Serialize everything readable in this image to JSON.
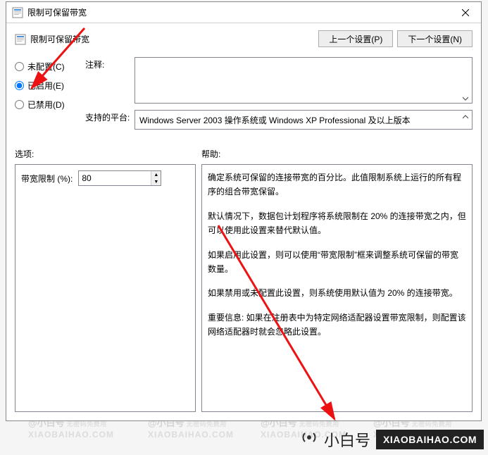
{
  "window": {
    "title": "限制可保留带宽"
  },
  "header": {
    "policy_name": "限制可保留带宽",
    "prev_btn": "上一个设置(P)",
    "next_btn": "下一个设置(N)"
  },
  "config": {
    "radios": {
      "not_configured": "未配置(C)",
      "enabled": "已启用(E)",
      "disabled": "已禁用(D)"
    },
    "selected": "enabled",
    "comment_label": "注释:",
    "comment_value": "",
    "platform_label": "支持的平台:",
    "platform_value": "Windows Server 2003 操作系统或 Windows XP Professional 及以上版本"
  },
  "sections": {
    "options_label": "选项:",
    "help_label": "帮助:"
  },
  "options": {
    "bandwidth_limit_label": "带宽限制 (%):",
    "bandwidth_limit_value": "80"
  },
  "help": {
    "p1": "确定系统可保留的连接带宽的百分比。此值限制系统上运行的所有程序的组合带宽保留。",
    "p2": "默认情况下，数据包计划程序将系统限制在 20% 的连接带宽之内，但可以使用此设置来替代默认值。",
    "p3": "如果启用此设置，则可以使用“带宽限制”框来调整系统可保留的带宽数量。",
    "p4": "如果禁用或未配置此设置，则系统使用默认值为 20% 的连接带宽。",
    "p5": "重要信息: 如果在注册表中为特定网络适配器设置带宽限制，则配置该网络适配器时就会忽略此设置。"
  },
  "footer": {
    "brand_cn": "小白号",
    "brand_domain": "XIAOBAIHAO.COM"
  },
  "watermark": {
    "cn": "@小白号",
    "sub": "无密码免费用",
    "dom": "XIAOBAIHAO.COM"
  }
}
